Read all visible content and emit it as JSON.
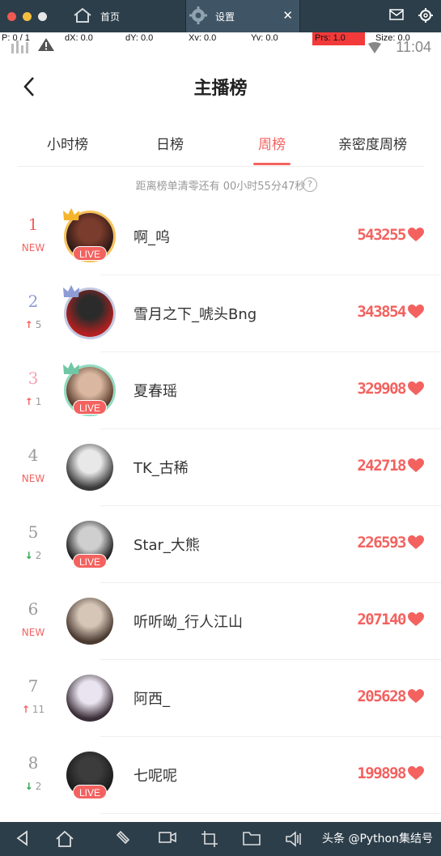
{
  "window": {
    "tabs": [
      {
        "label": "首页"
      },
      {
        "label": "设置"
      }
    ],
    "close_glyph": "✕"
  },
  "debug": {
    "p": "P: 0 / 1",
    "dx": "dX: 0.0",
    "dy": "dY: 0.0",
    "xv": "Xv: 0.0",
    "yv": "Yv: 0.0",
    "prs": "Prs: 1.0",
    "size": "Size: 0.0"
  },
  "status": {
    "time": "11:04"
  },
  "header": {
    "title": "主播榜"
  },
  "tabs": [
    {
      "label": "小时榜",
      "active": false
    },
    {
      "label": "日榜",
      "active": false
    },
    {
      "label": "周榜",
      "active": true
    },
    {
      "label": "亲密度周榜",
      "active": false
    }
  ],
  "countdown": "距离榜单清零还有 00小时55分47秒",
  "help_glyph": "?",
  "ranking": [
    {
      "rank": "1",
      "change": "NEW",
      "change_type": "new",
      "name": "啊_呜",
      "score": "543255",
      "live": true,
      "crown": "gold"
    },
    {
      "rank": "2",
      "change": "5",
      "change_type": "up",
      "name": "雪月之下_唬头Bng",
      "score": "343854",
      "live": false,
      "crown": "silver"
    },
    {
      "rank": "3",
      "change": "1",
      "change_type": "up",
      "name": "夏春瑶",
      "score": "329908",
      "live": true,
      "crown": "bronze"
    },
    {
      "rank": "4",
      "change": "NEW",
      "change_type": "new",
      "name": "TK_古稀",
      "score": "242718",
      "live": false,
      "crown": ""
    },
    {
      "rank": "5",
      "change": "2",
      "change_type": "down",
      "name": "Star_大熊",
      "score": "226593",
      "live": true,
      "crown": ""
    },
    {
      "rank": "6",
      "change": "NEW",
      "change_type": "new",
      "name": "听听呦_行人江山",
      "score": "207140",
      "live": false,
      "crown": ""
    },
    {
      "rank": "7",
      "change": "11",
      "change_type": "up",
      "name": "阿西_",
      "score": "205628",
      "live": false,
      "crown": ""
    },
    {
      "rank": "8",
      "change": "2",
      "change_type": "down",
      "name": "七呢呢",
      "score": "199898",
      "live": true,
      "crown": ""
    }
  ],
  "live_label": "LIVE",
  "rank_colors": [
    "#f3625f",
    "#8d9bd6",
    "#f4a3b2",
    "#999999",
    "#999999",
    "#999999",
    "#999999",
    "#999999"
  ],
  "icons": [
    "back-icon",
    "home-icon",
    "gear-icon",
    "mail-icon",
    "settings-icon",
    "question-icon",
    "heart-icon",
    "arrow-up-icon",
    "arrow-down-icon",
    "crown-icon",
    "android-back-icon",
    "android-home-icon"
  ],
  "watermark": "头条 @Python集结号"
}
